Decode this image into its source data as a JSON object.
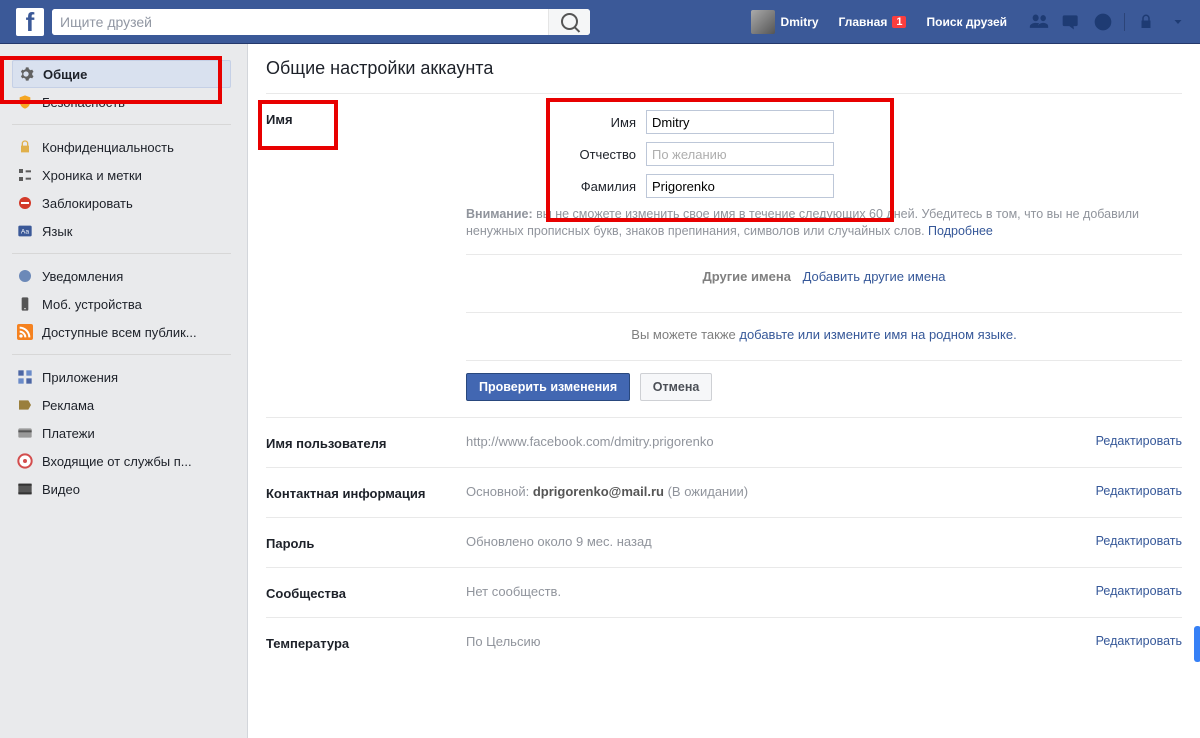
{
  "header": {
    "search_placeholder": "Ищите друзей",
    "profile_name": "Dmitry",
    "home": "Главная",
    "home_badge": "1",
    "find_friends": "Поиск друзей"
  },
  "sidebar": {
    "group1": [
      {
        "label": "Общие",
        "icon": "gear",
        "active": true
      },
      {
        "label": "Безопасность",
        "icon": "shield"
      }
    ],
    "group2": [
      {
        "label": "Конфиденциальность",
        "icon": "lock"
      },
      {
        "label": "Хроника и метки",
        "icon": "timeline"
      },
      {
        "label": "Заблокировать",
        "icon": "block"
      },
      {
        "label": "Язык",
        "icon": "lang"
      }
    ],
    "group3": [
      {
        "label": "Уведомления",
        "icon": "globe"
      },
      {
        "label": "Моб. устройства",
        "icon": "mobile"
      },
      {
        "label": "Доступные всем публик...",
        "icon": "rss"
      }
    ],
    "group4": [
      {
        "label": "Приложения",
        "icon": "apps"
      },
      {
        "label": "Реклама",
        "icon": "ads"
      },
      {
        "label": "Платежи",
        "icon": "card"
      },
      {
        "label": "Входящие от службы п...",
        "icon": "support"
      },
      {
        "label": "Видео",
        "icon": "video"
      }
    ]
  },
  "page": {
    "title": "Общие настройки аккаунта",
    "name_section": {
      "label": "Имя",
      "first_label": "Имя",
      "first_value": "Dmitry",
      "middle_label": "Отчество",
      "middle_placeholder": "По желанию",
      "last_label": "Фамилия",
      "last_value": "Prigorenko",
      "warning_bold": "Внимание:",
      "warning_text": " вы не сможете изменить свое имя в течение следующих 60 дней. Убедитесь в том, что вы не добавили ненужных прописных букв, знаков препинания, символов или случайных слов. ",
      "warning_link": "Подробнее",
      "other_names_label": "Другие имена",
      "other_names_link": "Добавить другие имена",
      "native_prefix": "Вы можете также ",
      "native_link": "добавьте или измените имя на родном языке.",
      "btn_review": "Проверить изменения",
      "btn_cancel": "Отмена"
    },
    "rows": {
      "username": {
        "label": "Имя пользователя",
        "value": "http://www.facebook.com/dmitry.prigorenko",
        "edit": "Редактировать"
      },
      "contact": {
        "label": "Контактная информация",
        "prefix": "Основной: ",
        "bold": "dprigorenko@mail.ru",
        "suffix": " (В ожидании)",
        "edit": "Редактировать"
      },
      "password": {
        "label": "Пароль",
        "value": "Обновлено около 9 мес. назад",
        "edit": "Редактировать"
      },
      "networks": {
        "label": "Сообщества",
        "value": "Нет сообществ.",
        "edit": "Редактировать"
      },
      "temperature": {
        "label": "Температура",
        "value": "По Цельсию",
        "edit": "Редактировать"
      }
    }
  }
}
